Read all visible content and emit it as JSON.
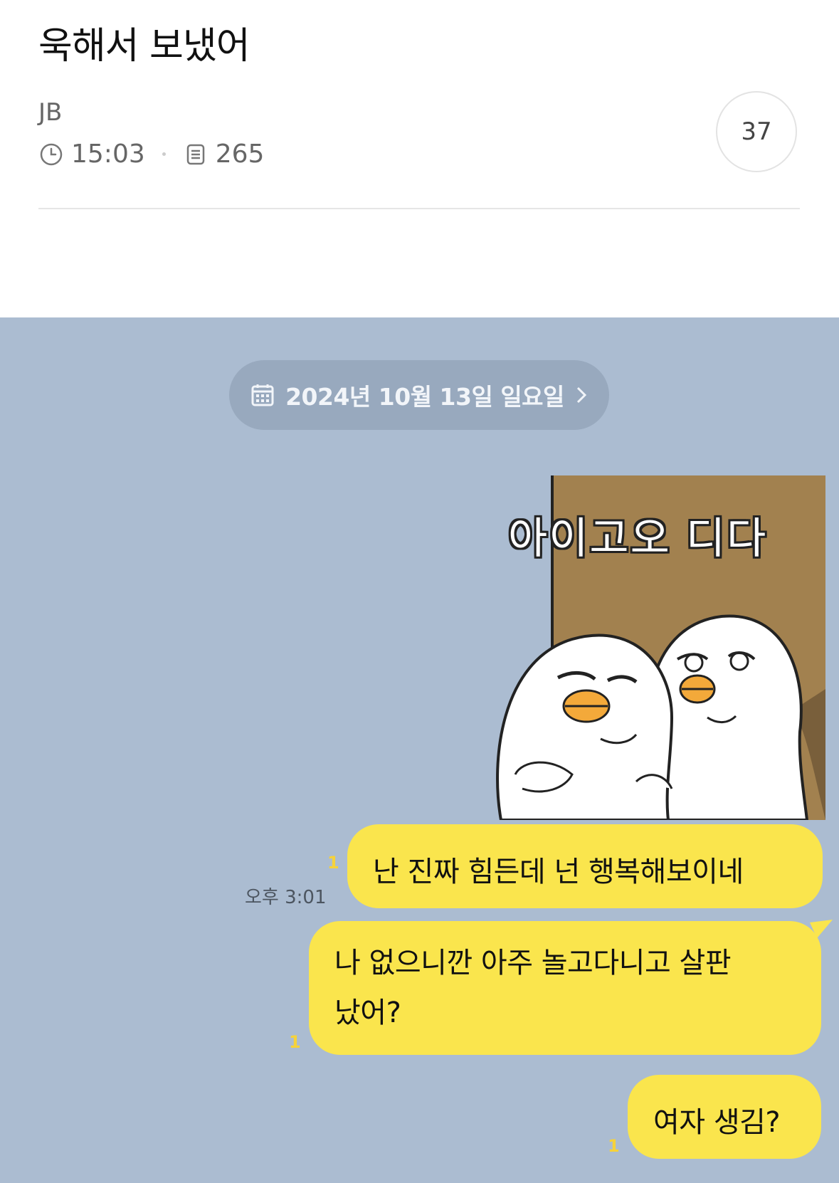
{
  "post": {
    "title": "욱해서 보냈어",
    "author": "JB",
    "time": "15:03",
    "views": "265",
    "comment_count": "37"
  },
  "chat": {
    "date_label": "2024년 10월 13일 일요일",
    "sticker_text": "아이고오 디다",
    "messages": [
      {
        "text": "난 진짜 힘든데 넌 행복해보이네",
        "unread": "1",
        "time": "오후 3:01"
      },
      {
        "text_line1": "나 없으니깐 아주 놀고다니고 살판",
        "text_line2": "났어?",
        "unread": "1"
      },
      {
        "text": "여자 생김?",
        "unread": "1"
      }
    ],
    "colors": {
      "background": "#abbcd1",
      "bubble": "#fae54d",
      "date_pill": "#98a9be",
      "sticker_door": "#a2814f"
    }
  }
}
